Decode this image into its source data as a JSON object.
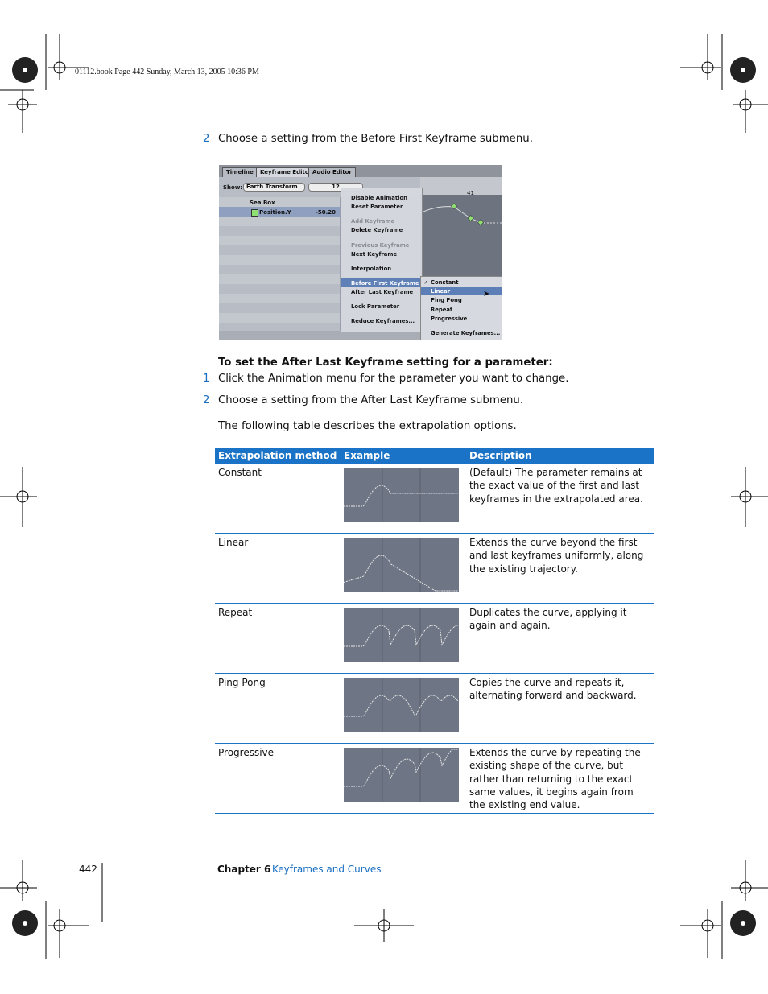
{
  "slug": "01112.book  Page 442  Sunday, March 13, 2005  10:36 PM",
  "steps_top": [
    {
      "num": "2",
      "text": "Choose a setting from the Before First Keyframe submenu."
    }
  ],
  "screenshot": {
    "tabs": [
      "Timeline",
      "Keyframe Editor",
      "Audio Editor"
    ],
    "show_label": "Show:",
    "show_value": "Earth Transform",
    "frame_value": "12",
    "ruler_mark": "41",
    "group": "Sea Box",
    "param": "Position.Y",
    "param_value": "-50.20",
    "menu": [
      "Disable Animation",
      "Reset Parameter",
      "Add Keyframe",
      "Delete Keyframe",
      "Previous Keyframe",
      "Next Keyframe",
      "Interpolation",
      "Before First Keyframe",
      "After Last Keyframe",
      "Lock Parameter",
      "Reduce Keyframes..."
    ],
    "submenu": [
      "Constant",
      "Linear",
      "Ping Pong",
      "Repeat",
      "Progressive",
      "Generate Keyframes..."
    ],
    "checked": "Constant"
  },
  "heading": "To set the After Last Keyframe setting for a parameter:",
  "steps": [
    {
      "num": "1",
      "text": "Click the Animation menu for the parameter you want to change."
    },
    {
      "num": "2",
      "text": "Choose a setting from the After Last Keyframe submenu."
    }
  ],
  "intro": "The following table describes the extrapolation options.",
  "table": {
    "headers": [
      "Extrapolation method",
      "Example",
      "Description"
    ],
    "rows": [
      {
        "method": "Constant",
        "desc": "(Default) The parameter remains at the exact value of the first and last keyframes in the extrapolated area."
      },
      {
        "method": "Linear",
        "desc": "Extends the curve beyond the first and last keyframes uniformly, along the existing trajectory."
      },
      {
        "method": "Repeat",
        "desc": "Duplicates the curve, applying it again and again."
      },
      {
        "method": "Ping Pong",
        "desc": "Copies the curve and repeats it, alternating forward and backward."
      },
      {
        "method": "Progressive",
        "desc": "Extends the curve by repeating the existing shape of the curve, but rather than returning to the exact same values, it begins again from the existing end value."
      }
    ]
  },
  "footer": {
    "page": "442",
    "chapter": "Chapter 6",
    "title": "Keyframes and Curves"
  },
  "colors": {
    "accent": "#1a73c6"
  }
}
